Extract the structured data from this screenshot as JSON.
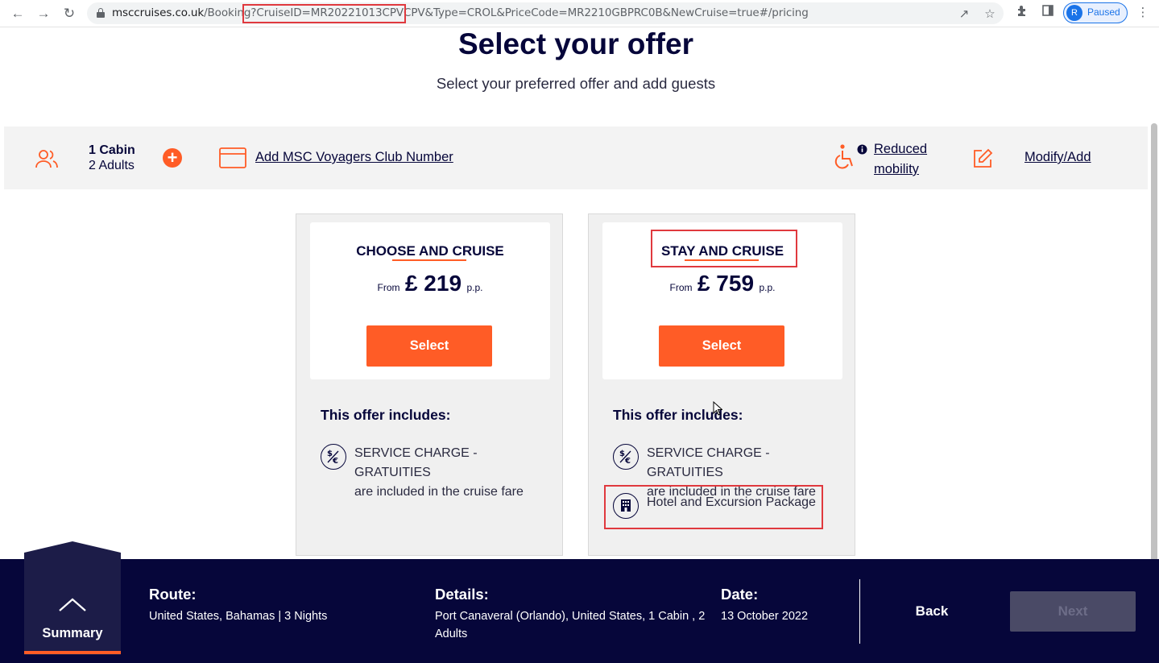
{
  "browser": {
    "url_host": "msccruises.co.uk",
    "url_path_start": "/Booking",
    "url_highlight": "?CruiseID=MR20221013CPVCPV",
    "url_rest": "&Type=CROL&PriceCode=MR2210GBPRC0B&NewCruise=true#/pricing",
    "profile_initial": "R",
    "profile_status": "Paused"
  },
  "header": {
    "title": "Select your offer",
    "subtitle": "Select your preferred offer and add guests"
  },
  "guest_bar": {
    "cabins": "1 Cabin",
    "adults": "2 Adults",
    "voyagers_link": "Add MSC Voyagers Club Number",
    "mobility_line1": "Reduced",
    "mobility_line2": "mobility",
    "modify_link": "Modify/Add"
  },
  "offers": [
    {
      "name": "CHOOSE AND CRUISE",
      "from_label": "From",
      "price": "£ 219",
      "pp_label": "p.p.",
      "select_label": "Select",
      "includes_title": "This offer includes:",
      "items": [
        {
          "line1": "SERVICE CHARGE - GRATUITIES",
          "line2": "are included in the cruise fare",
          "icon": "currency-exchange-icon"
        }
      ]
    },
    {
      "name": "STAY AND CRUISE",
      "from_label": "From",
      "price": "£ 759",
      "pp_label": "p.p.",
      "select_label": "Select",
      "includes_title": "This offer includes:",
      "items": [
        {
          "line1": "SERVICE CHARGE - GRATUITIES",
          "line2": "are included in the cruise fare",
          "icon": "currency-exchange-icon"
        },
        {
          "line1": "Hotel and Excursion Package",
          "line2": "",
          "icon": "hotel-icon"
        }
      ]
    }
  ],
  "footer": {
    "summary_label": "Summary",
    "route_label": "Route:",
    "route_value": "United States, Bahamas | 3 Nights",
    "details_label": "Details:",
    "details_line1": "Port Canaveral (Orlando), United States, 1 Cabin , 2",
    "details_line2": "Adults",
    "date_label": "Date:",
    "date_value": "13 October 2022",
    "back_label": "Back",
    "next_label": "Next"
  },
  "colors": {
    "navy": "#06063a",
    "accent_orange": "#ff5c26",
    "annotation_red": "#e0393e",
    "card_gray": "#f0f0f0"
  }
}
